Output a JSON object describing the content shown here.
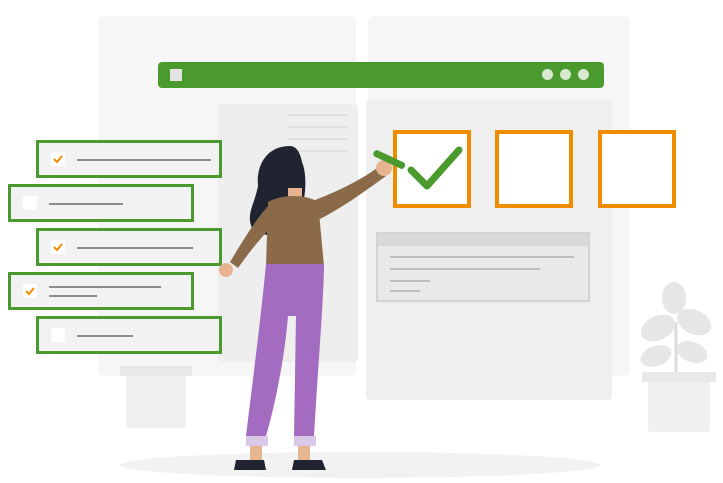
{
  "scene": {
    "description_icons": [
      "checklist-icon",
      "checkmark-icon",
      "plant-icon",
      "person-illustration"
    ],
    "colors": {
      "brand_green": "#4a9a2e",
      "accent_orange": "#f08c00",
      "panel_gray": "#f1f1f1",
      "text_line_gray": "#8c8c8c",
      "person_sweater": "#8b6a4a",
      "person_pants": "#a46cc1",
      "person_hair": "#1f2430"
    }
  },
  "checklist": {
    "items": [
      {
        "checked": true
      },
      {
        "checked": false
      },
      {
        "checked": true
      },
      {
        "checked": true
      },
      {
        "checked": false
      }
    ]
  },
  "choice_boxes": [
    {
      "state": "checked"
    },
    {
      "state": "empty"
    },
    {
      "state": "empty"
    }
  ]
}
